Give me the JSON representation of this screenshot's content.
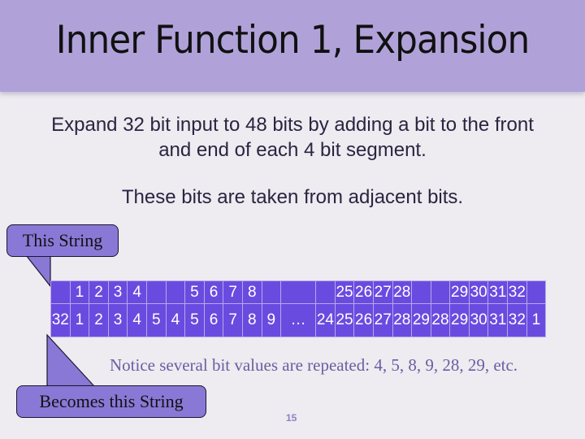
{
  "slide": {
    "title": "Inner Function 1,  Expansion",
    "line1": "Expand 32 bit input to 48 bits by adding a bit to the front and end of each 4 bit segment.",
    "line2": "These bits are taken from adjacent bits.",
    "callout_top": "This String",
    "callout_bottom": "Becomes this String",
    "notice": "Notice several bit values are repeated: 4, 5, 8, 9, 28, 29, etc.",
    "page_number": "15"
  },
  "table": {
    "input_row": [
      "",
      "1",
      "2",
      "3",
      "4",
      "",
      "",
      "5",
      "6",
      "7",
      "8",
      "",
      "",
      "",
      "25",
      "26",
      "27",
      "28",
      "",
      "",
      "29",
      "30",
      "31",
      "32",
      ""
    ],
    "output_row": [
      "32",
      "1",
      "2",
      "3",
      "4",
      "5",
      "4",
      "5",
      "6",
      "7",
      "8",
      "9",
      "…",
      "24",
      "25",
      "26",
      "27",
      "28",
      "29",
      "28",
      "29",
      "30",
      "31",
      "32",
      "1"
    ]
  },
  "colors": {
    "title_band": "#b0a2d9",
    "table_fill": "#6a4be0",
    "callout_fill": "#8a78d6",
    "notice_text": "#6a5fa0"
  }
}
